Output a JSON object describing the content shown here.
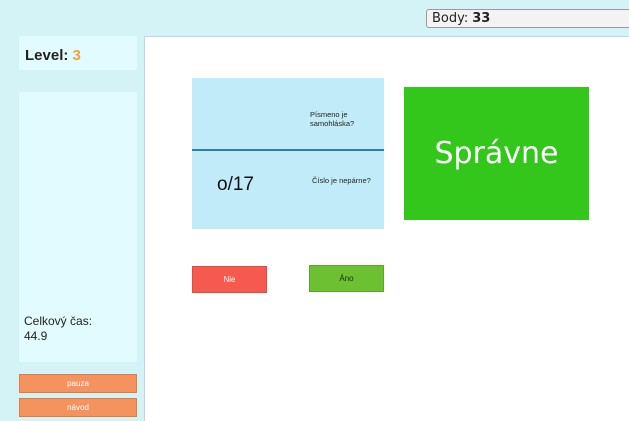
{
  "score": {
    "label": "Body:",
    "value": "33"
  },
  "level": {
    "label": "Level:",
    "value": "3",
    "value_color": "#f7a13d"
  },
  "timer": {
    "label": "Celkový čas:",
    "value": "44.9"
  },
  "controls": {
    "pause_label": "pauza",
    "guide_label": "návod"
  },
  "card": {
    "top_question": "Písmeno je samohláska?",
    "bottom_question": "Číslo je nepárne?",
    "value": "o/17"
  },
  "feedback": {
    "text": "Správne",
    "color": "#33c71b"
  },
  "answers": {
    "no_label": "Nie",
    "yes_label": "Áno",
    "no_color": "#f65a4e",
    "yes_color": "#6cc031"
  }
}
